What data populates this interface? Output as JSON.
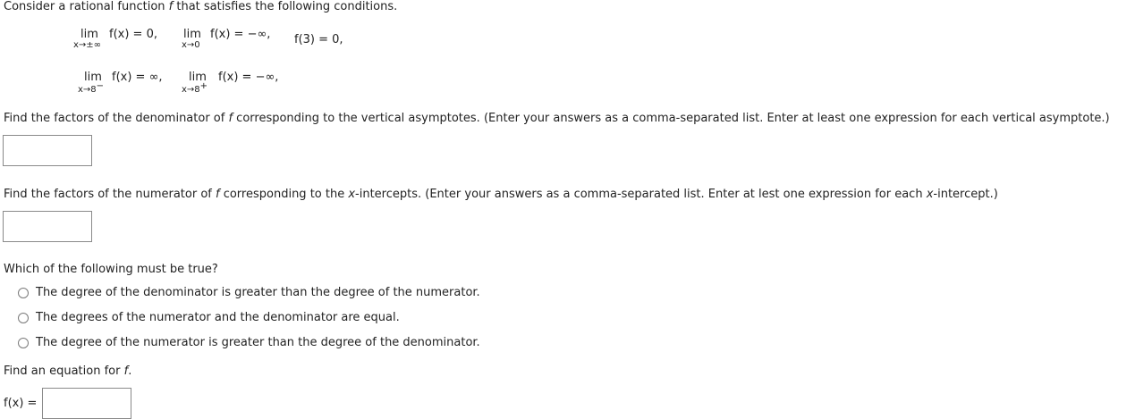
{
  "intro": {
    "before": "Consider a rational function ",
    "var": "f",
    "after": " that satisfies the following conditions."
  },
  "conditions": {
    "c1": {
      "lim": "lim",
      "func": "f(x)",
      "result": " = 0,",
      "sub": "x→±∞"
    },
    "c2": {
      "lim": "lim",
      "func": "f(x)",
      "result": " = −∞,",
      "sub": "x→0"
    },
    "c3": {
      "value": "f(3) = 0,"
    },
    "c4": {
      "lim": "lim",
      "func": "f(x)",
      "result": " = ∞,",
      "sub": "x→8",
      "sup": "−"
    },
    "c5": {
      "lim": "lim",
      "func": "f(x)",
      "result": " = −∞,",
      "sub": "x→8",
      "sup": "+"
    }
  },
  "q1": {
    "before": "Find the factors of the denominator of ",
    "var": "f",
    "after": " corresponding to the vertical asymptotes. (Enter your answers as a comma-separated list. Enter at least one expression for each vertical asymptote.)",
    "value": ""
  },
  "q2": {
    "before": "Find the factors of the numerator of ",
    "var": "f",
    "mid": " corresponding to the ",
    "var2": "x",
    "after": "-intercepts. (Enter your answers as a comma-separated list. Enter at lest one expression for each ",
    "var3": "x",
    "end": "-intercept.)",
    "value": ""
  },
  "q3": {
    "prompt": "Which of the following must be true?",
    "options": [
      "The degree of the denominator is greater than the degree of the numerator.",
      "The degrees of the numerator and the denominator are equal.",
      "The degree of the numerator is greater than the degree of the denominator."
    ]
  },
  "q4": {
    "before": "Find an equation for ",
    "var": "f",
    "after": ".",
    "label": "f(x)",
    "eq": " =",
    "value": ""
  }
}
